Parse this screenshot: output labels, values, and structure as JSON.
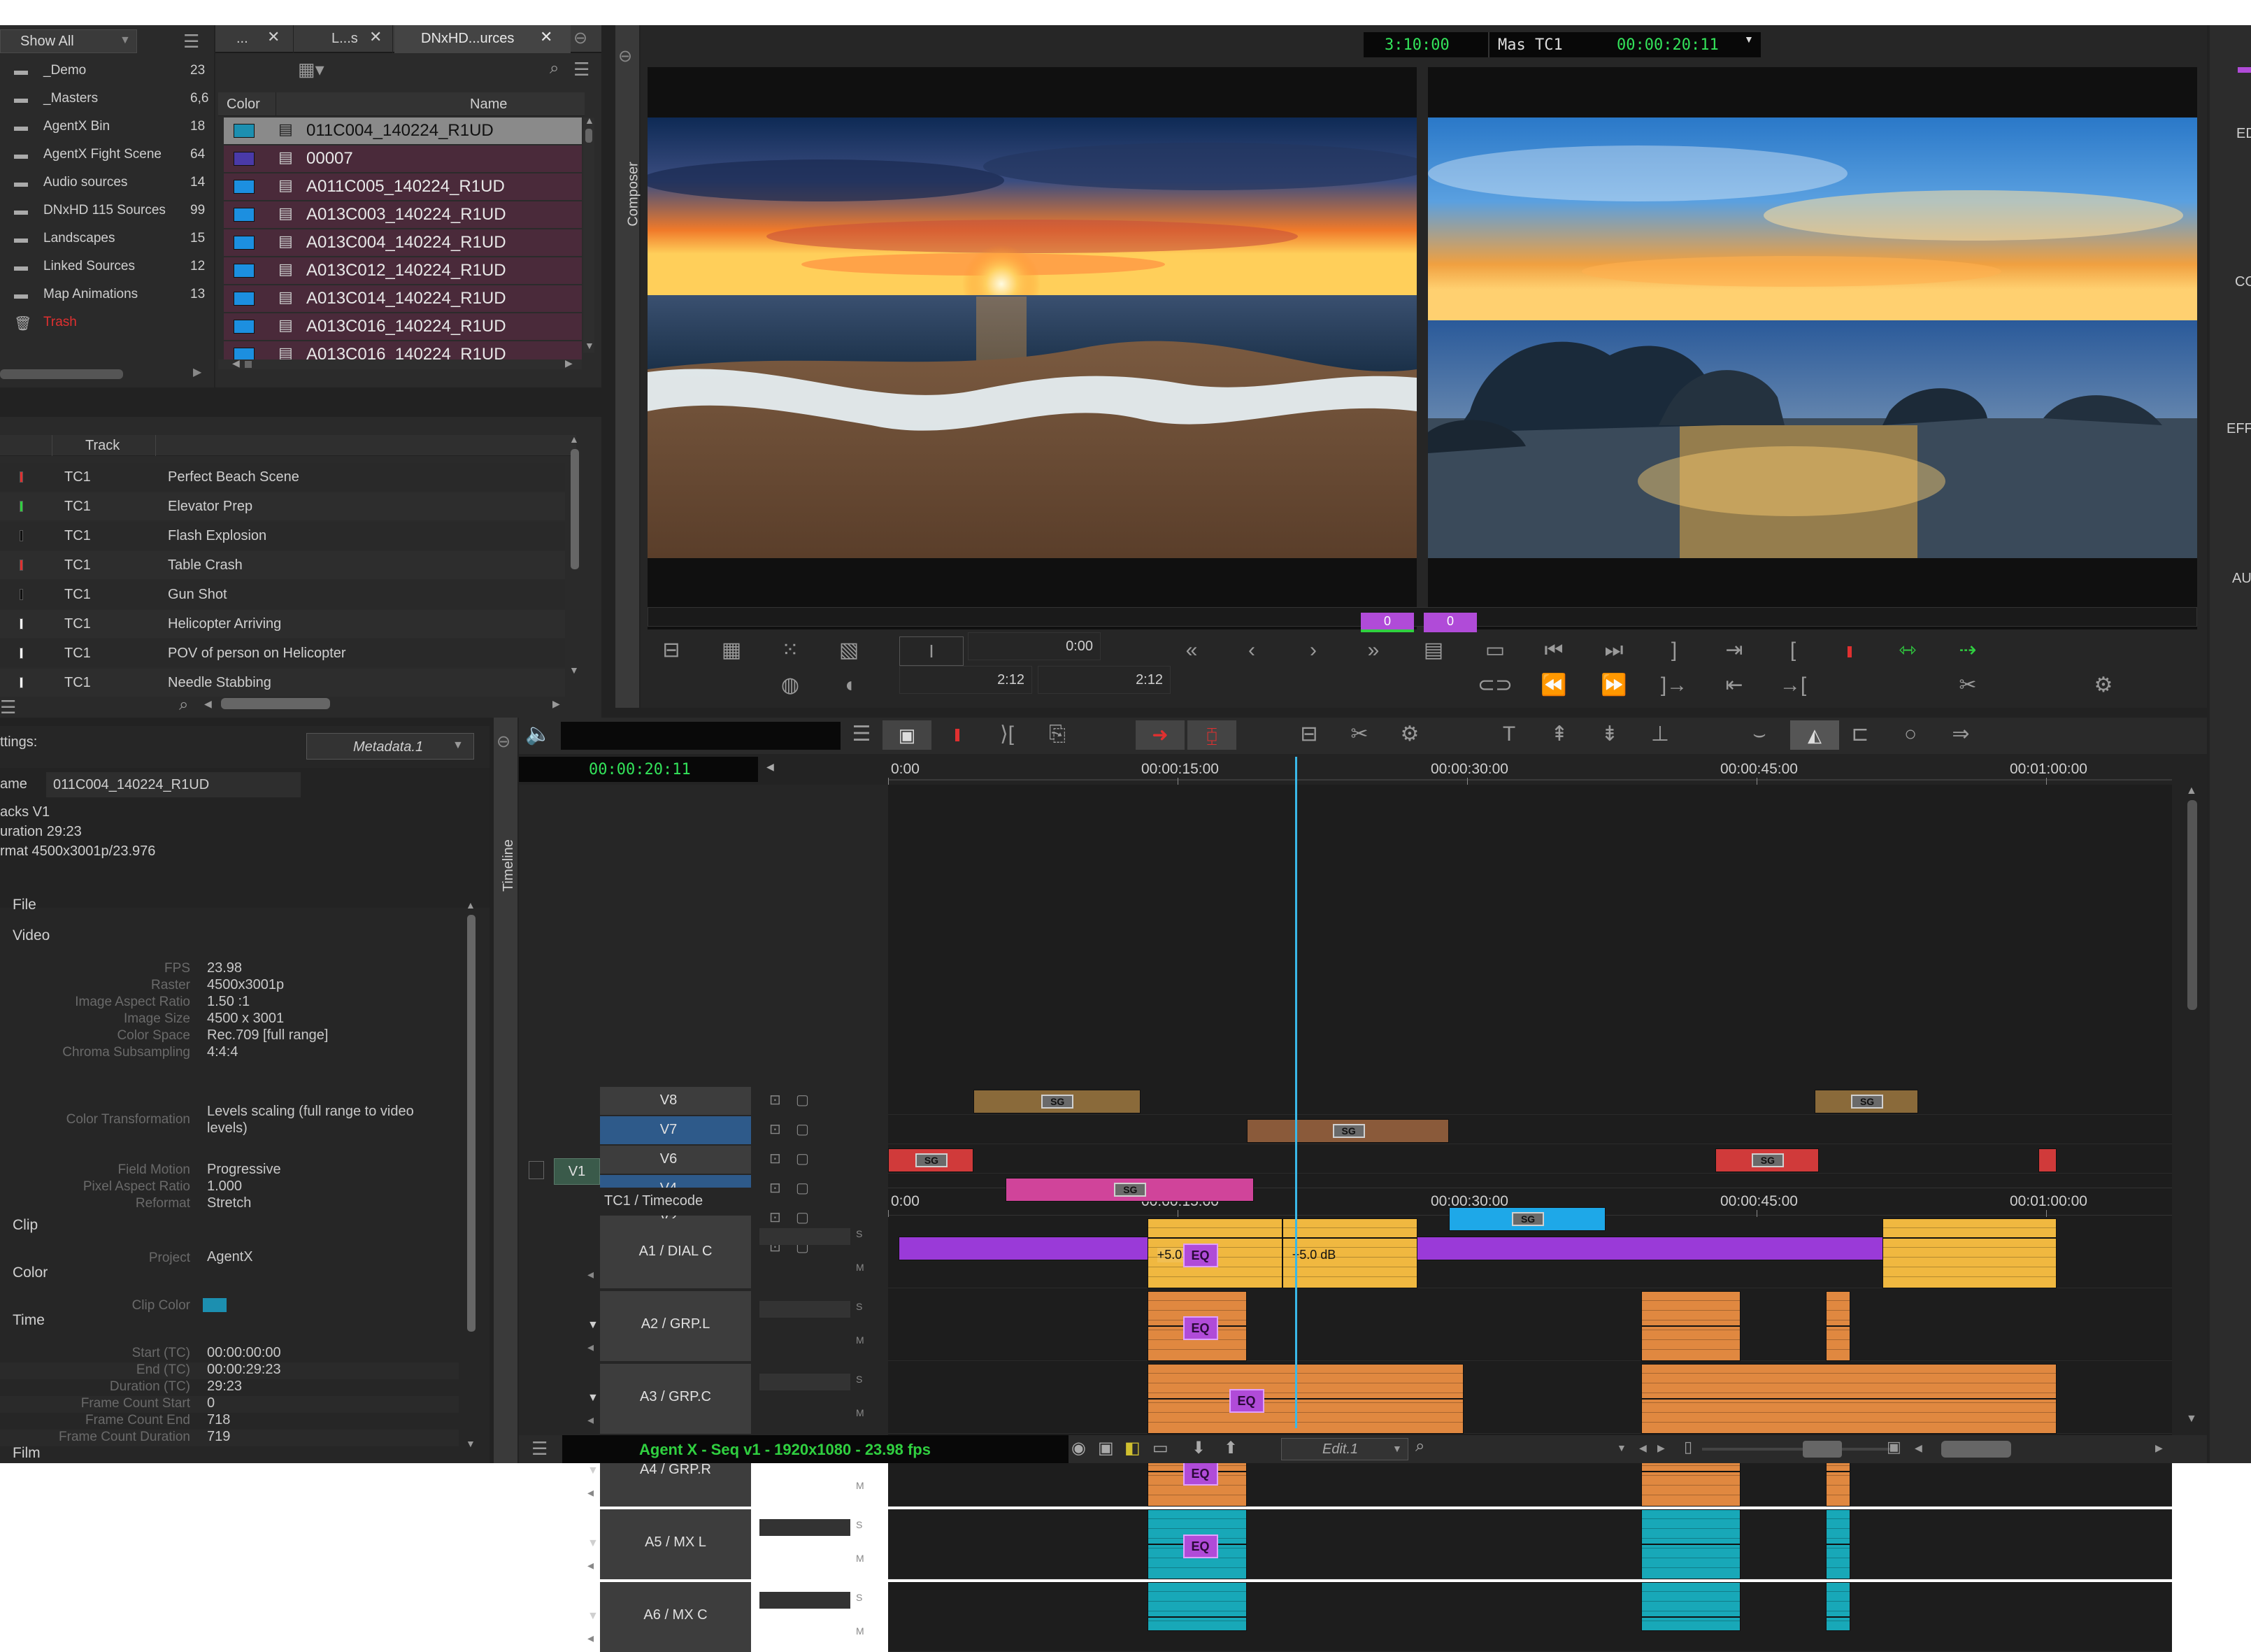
{
  "bin_list": {
    "filter": "Show All",
    "items": [
      {
        "name": "_Demo",
        "count": "23"
      },
      {
        "name": "_Masters",
        "count": "6,6"
      },
      {
        "name": "AgentX Bin",
        "count": "18"
      },
      {
        "name": "AgentX Fight Scene",
        "count": "64"
      },
      {
        "name": "Audio sources",
        "count": "14"
      },
      {
        "name": "DNxHD 115 Sources",
        "count": "99"
      },
      {
        "name": "Landscapes",
        "count": "15"
      },
      {
        "name": "Linked Sources",
        "count": "12"
      },
      {
        "name": "Map Animations",
        "count": "13"
      },
      {
        "name": "Trash",
        "count": ""
      }
    ]
  },
  "bin_tabs": [
    "...",
    "L...s",
    "DNxHD...urces"
  ],
  "clip_list": {
    "col_color": "Color",
    "col_name": "Name",
    "rows": [
      {
        "name": "011C004_140224_R1UD",
        "color": "#1c8fb0"
      },
      {
        "name": "00007",
        "color": "#4a3aa8"
      },
      {
        "name": "A011C005_140224_R1UD",
        "color": "#1c8fe0"
      },
      {
        "name": "A013C003_140224_R1UD",
        "color": "#1c8fe0"
      },
      {
        "name": "A013C004_140224_R1UD",
        "color": "#1c8fe0"
      },
      {
        "name": "A013C012_140224_R1UD",
        "color": "#1c8fe0"
      },
      {
        "name": "A013C014_140224_R1UD",
        "color": "#1c8fe0"
      },
      {
        "name": "A013C016_140224_R1UD",
        "color": "#1c8fe0"
      },
      {
        "name": "A013C016_140224_R1UD",
        "color": "#1c8fe0"
      }
    ]
  },
  "marker_list": {
    "col_track": "Track",
    "rows": [
      {
        "track": "TC1",
        "name": "Perfect Beach Scene",
        "color": "#e03030"
      },
      {
        "track": "TC1",
        "name": "Elevator Prep",
        "color": "#30d040"
      },
      {
        "track": "TC1",
        "name": "Flash Explosion",
        "color": "#111111"
      },
      {
        "track": "TC1",
        "name": "Table Crash",
        "color": "#e03030"
      },
      {
        "track": "TC1",
        "name": "Gun Shot",
        "color": "#111111"
      },
      {
        "track": "TC1",
        "name": "Helicopter Arriving",
        "color": "#ffffff"
      },
      {
        "track": "TC1",
        "name": "POV of person on Helicopter",
        "color": "#ffffff"
      },
      {
        "track": "TC1",
        "name": "Needle Stabbing",
        "color": "#ffffff"
      }
    ]
  },
  "metadata": {
    "settings_label": "ttings:",
    "view": "Metadata.1",
    "name_label": "ame",
    "name_value": "011C004_140224_R1UD",
    "tracks": "acks  V1",
    "duration": "uration 29:23",
    "format": "rmat   4500x3001p/23.976",
    "sections": {
      "file": "File",
      "video": "Video",
      "clip": "Clip",
      "color": "Color",
      "time": "Time",
      "film": "Film"
    },
    "video_fields": [
      {
        "k": "FPS",
        "v": "23.98"
      },
      {
        "k": "Raster",
        "v": "4500x3001p"
      },
      {
        "k": "Image Aspect Ratio",
        "v": "1.50 :1"
      },
      {
        "k": "Image Size",
        "v": "4500 x 3001"
      },
      {
        "k": "Color Space",
        "v": "Rec.709 [full range]"
      },
      {
        "k": "Chroma Subsampling",
        "v": "4:4:4"
      }
    ],
    "color_transformation_key": "Color Transformation",
    "color_transformation_val1": "Levels scaling (full range to video",
    "color_transformation_val2": "levels)",
    "video_fields2": [
      {
        "k": "Field Motion",
        "v": "Progressive"
      },
      {
        "k": "Pixel Aspect Ratio",
        "v": "1.000"
      },
      {
        "k": "Reformat",
        "v": "Stretch"
      }
    ],
    "project_key": "Project",
    "project_val": "AgentX",
    "clip_color_key": "Clip Color",
    "clip_color": "#1c8fb0",
    "time_fields": [
      {
        "k": "Start (TC)",
        "v": "00:00:00:00"
      },
      {
        "k": "End (TC)",
        "v": "00:00:29:23"
      },
      {
        "k": "Duration (TC)",
        "v": "29:23"
      },
      {
        "k": "Frame Count Start",
        "v": "0"
      },
      {
        "k": "Frame Count End",
        "v": "718"
      },
      {
        "k": "Frame Count Duration",
        "v": "719"
      }
    ]
  },
  "composer": {
    "side_label": "Composer",
    "tc_left": "3:10:00",
    "tc_mode": "Mas  TC1",
    "tc_right": "00:00:20:11",
    "counter_a": "0",
    "counter_b": "0",
    "dur_top": "0:00",
    "dur_left": "2:12",
    "dur_right": "2:12"
  },
  "right_palette": [
    "ED",
    "CO",
    "EFF",
    "AU"
  ],
  "timeline": {
    "side_label": "Timeline",
    "timecode": "00:00:20:11",
    "ruler": [
      "0:00",
      "00:00:15:00",
      "00:00:30:00",
      "00:00:45:00",
      "00:01:00:00"
    ],
    "video_tracks": [
      "V8",
      "V7",
      "V6",
      "V4",
      "V2",
      "V1"
    ],
    "source_track": "V1",
    "tc_track": "TC1 / Timecode",
    "audio_tracks": [
      "A1 / DIAL C",
      "A2 / GRP.L",
      "A3 / GRP.C",
      "A4 / GRP.R",
      "A5 / MX L",
      "A6 / MX C"
    ],
    "gain_a": "+5.0 dB",
    "gain_b": "+5.0 dB",
    "clip_tag": "SG",
    "eq_label": "EQ",
    "status": "Agent X - Seq v1 - 1920x1080 - 23.98 fps",
    "edit_view": "Edit.1",
    "colors": {
      "v8": "#8a6a3a",
      "v7": "#8a5a3a",
      "v6": "#d03a3a",
      "v4": "#d0449a",
      "v2": "#1ea8e8",
      "v1": "#9a3ad8",
      "a1": "#f0b840",
      "a_orange": "#e08840",
      "a_teal": "#18a8b8"
    }
  }
}
